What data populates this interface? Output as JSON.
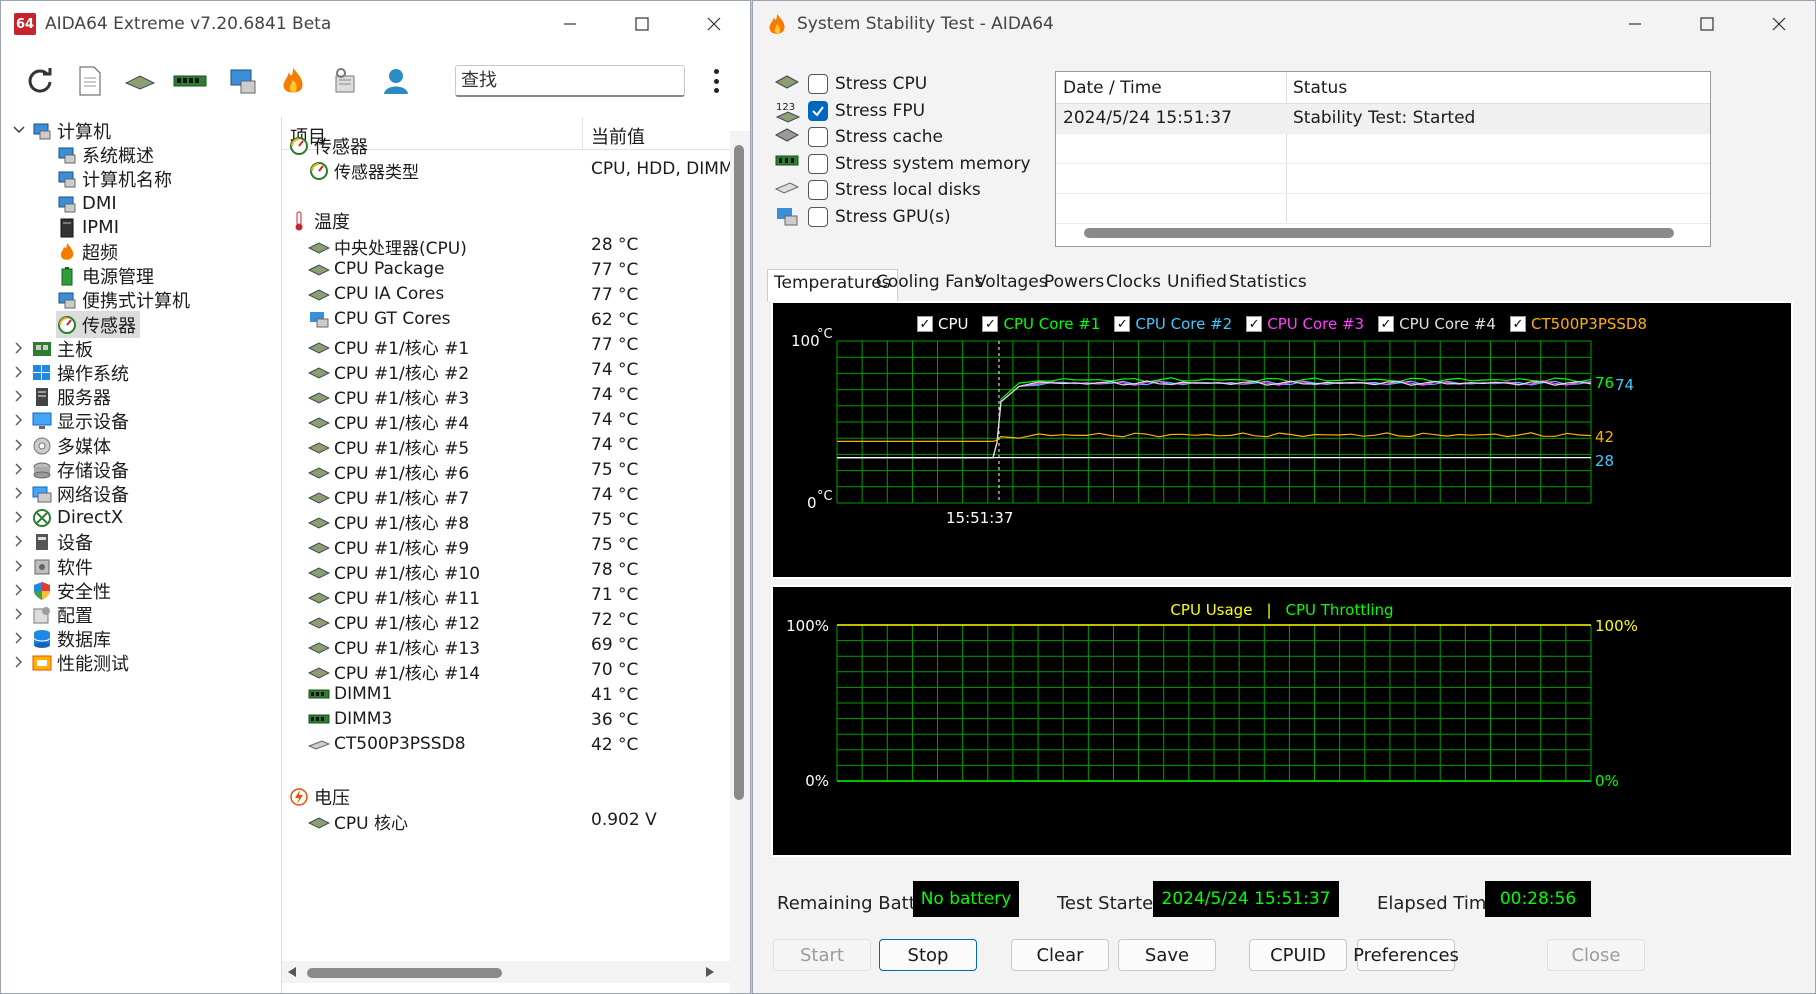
{
  "main_window": {
    "title": "AIDA64 Extreme v7.20.6841 Beta",
    "logo_text": "64",
    "search_placeholder": "查找",
    "toolbar": [
      "refresh-icon",
      "report-icon",
      "motherboard-icon",
      "memory-icon",
      "computer-icon",
      "flame-icon",
      "tools-icon",
      "user-icon"
    ]
  },
  "tree": {
    "root": "计算机",
    "children": [
      "系统概述",
      "计算机名称",
      "DMI",
      "IPMI",
      "超频",
      "电源管理",
      "便携式计算机",
      "传感器"
    ],
    "selected": "传感器",
    "groups": [
      "主板",
      "操作系统",
      "服务器",
      "显示设备",
      "多媒体",
      "存储设备",
      "网络设备",
      "DirectX",
      "设备",
      "软件",
      "安全性",
      "配置",
      "数据库",
      "性能测试"
    ]
  },
  "list": {
    "col_item": "项目",
    "col_value": "当前值",
    "sections": {
      "sensor": {
        "title": "传感器",
        "type_label": "传感器类型",
        "type_value": "CPU, HDD, DIMM"
      },
      "temperature": {
        "title": "温度",
        "rows": [
          {
            "name": "中央处理器(CPU)",
            "value": "28 °C"
          },
          {
            "name": "CPU Package",
            "value": "77 °C"
          },
          {
            "name": "CPU IA Cores",
            "value": "77 °C"
          },
          {
            "name": "CPU GT Cores",
            "value": "62 °C"
          },
          {
            "name": "CPU #1/核心 #1",
            "value": "77 °C"
          },
          {
            "name": "CPU #1/核心 #2",
            "value": "74 °C"
          },
          {
            "name": "CPU #1/核心 #3",
            "value": "74 °C"
          },
          {
            "name": "CPU #1/核心 #4",
            "value": "74 °C"
          },
          {
            "name": "CPU #1/核心 #5",
            "value": "74 °C"
          },
          {
            "name": "CPU #1/核心 #6",
            "value": "75 °C"
          },
          {
            "name": "CPU #1/核心 #7",
            "value": "74 °C"
          },
          {
            "name": "CPU #1/核心 #8",
            "value": "75 °C"
          },
          {
            "name": "CPU #1/核心 #9",
            "value": "75 °C"
          },
          {
            "name": "CPU #1/核心 #10",
            "value": "78 °C"
          },
          {
            "name": "CPU #1/核心 #11",
            "value": "71 °C"
          },
          {
            "name": "CPU #1/核心 #12",
            "value": "72 °C"
          },
          {
            "name": "CPU #1/核心 #13",
            "value": "69 °C"
          },
          {
            "name": "CPU #1/核心 #14",
            "value": "70 °C"
          },
          {
            "name": "DIMM1",
            "value": "41 °C"
          },
          {
            "name": "DIMM3",
            "value": "36 °C"
          },
          {
            "name": "CT500P3PSSD8",
            "value": "42 °C"
          }
        ]
      },
      "voltage": {
        "title": "电压",
        "rows": [
          {
            "name": "CPU 核心",
            "value": "0.902 V"
          }
        ]
      }
    }
  },
  "stability": {
    "title": "System Stability Test - AIDA64",
    "stress": [
      {
        "label": "Stress CPU",
        "checked": false,
        "icon": "cpu-chip-icon"
      },
      {
        "label": "Stress FPU",
        "checked": true,
        "icon": "fpu-123-icon"
      },
      {
        "label": "Stress cache",
        "checked": false,
        "icon": "cache-icon"
      },
      {
        "label": "Stress system memory",
        "checked": false,
        "icon": "memory-icon"
      },
      {
        "label": "Stress local disks",
        "checked": false,
        "icon": "disk-icon"
      },
      {
        "label": "Stress GPU(s)",
        "checked": false,
        "icon": "gpu-icon"
      }
    ],
    "log": {
      "col_datetime": "Date / Time",
      "col_status": "Status",
      "rows": [
        {
          "datetime": "2024/5/24 15:51:37",
          "status": "Stability Test: Started"
        }
      ]
    },
    "tabs": [
      "Temperatures",
      "Cooling Fans",
      "Voltages",
      "Powers",
      "Clocks",
      "Unified",
      "Statistics"
    ],
    "active_tab": "Temperatures",
    "status": {
      "battery_label": "Remaining Battery:",
      "battery_value": "No battery",
      "started_label": "Test Started:",
      "started_value": "2024/5/24 15:51:37",
      "elapsed_label": "Elapsed Time:",
      "elapsed_value": "00:28:56"
    },
    "buttons": {
      "start": "Start",
      "stop": "Stop",
      "clear": "Clear",
      "save": "Save",
      "cpuid": "CPUID",
      "preferences": "Preferences",
      "close": "Close"
    }
  },
  "colors": {
    "grid": "#00a000",
    "graph_bg": "#000000",
    "cpu": "#ffffff",
    "core1": "#00ff00",
    "core2": "#40c8ff",
    "core3": "#ff40ff",
    "core4": "#e0e0e0",
    "ssd": "#ffb000",
    "usage": "#ffff00",
    "throttle": "#00ff00"
  },
  "chart_data": [
    {
      "type": "line",
      "legend": [
        "CPU",
        "CPU Core #1",
        "CPU Core #2",
        "CPU Core #3",
        "CPU Core #4",
        "CT500P3PSSD8"
      ],
      "ymax_label": "100",
      "ymin_label": "0",
      "yunit": "°C",
      "ylim": [
        0,
        100
      ],
      "x_marker_label": "15:51:37",
      "right_labels": [
        "76",
        "74",
        "42",
        "28"
      ],
      "series": [
        {
          "name": "CPU Core #1",
          "color": "#00ff00",
          "baseline": 28,
          "rise": 76,
          "end": 76
        },
        {
          "name": "CPU Core #2",
          "color": "#40c8ff",
          "baseline": 28,
          "rise": 74,
          "end": 74
        },
        {
          "name": "CPU Core #3",
          "color": "#ff40ff",
          "baseline": 28,
          "rise": 74,
          "end": 74
        },
        {
          "name": "CPU Core #4",
          "color": "#e0e0e0",
          "baseline": 28,
          "rise": 74,
          "end": 74
        },
        {
          "name": "CT500P3PSSD8",
          "color": "#ffb000",
          "baseline": 38,
          "rise": 42,
          "end": 42
        },
        {
          "name": "CPU",
          "color": "#ffffff",
          "baseline": 28,
          "rise": 28,
          "end": 28
        }
      ]
    },
    {
      "type": "line",
      "legend": [
        "CPU Usage",
        "CPU Throttling"
      ],
      "legend_sep": "|",
      "ymax_label": "100%",
      "ymin_label": "0%",
      "right_max_label": "100%",
      "right_min_label": "0%",
      "ylim": [
        0,
        100
      ],
      "series": [
        {
          "name": "CPU Usage",
          "color": "#ffff00",
          "value": 100
        },
        {
          "name": "CPU Throttling",
          "color": "#00ff00",
          "value": 0
        }
      ]
    }
  ]
}
